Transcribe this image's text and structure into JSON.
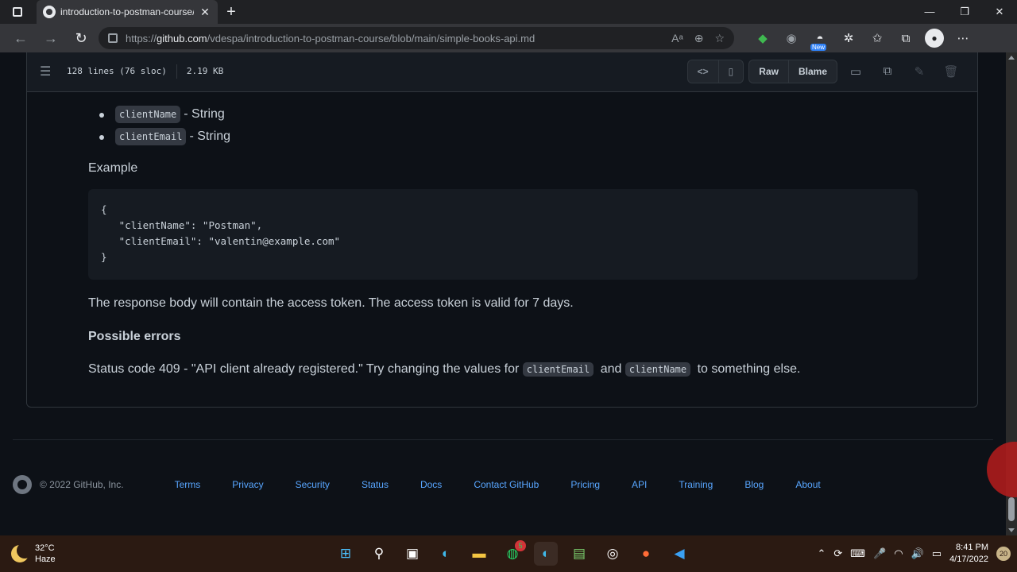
{
  "browser": {
    "tab_title": "introduction-to-postman-course/",
    "new_tab_symbol": "+",
    "close_symbol": "✕",
    "url_prefix": "https://",
    "url_host": "github.com",
    "url_path": "/vdespa/introduction-to-postman-course/blob/main/simple-books-api.md",
    "new_badge": "New"
  },
  "file_header": {
    "lines_info": "128 lines (76 sloc)",
    "size": "2.19 KB",
    "raw_label": "Raw",
    "blame_label": "Blame"
  },
  "content": {
    "fields": [
      {
        "code": "clientName",
        "type": "- String"
      },
      {
        "code": "clientEmail",
        "type": "- String"
      }
    ],
    "example_label": "Example",
    "code_block": "{\n   \"clientName\": \"Postman\",\n   \"clientEmail\": \"valentin@example.com\"\n}",
    "response_text": "The response body will contain the access token. The access token is valid for 7 days.",
    "errors_heading": "Possible errors",
    "status_text_a": "Status code 409 - \"API client already registered.\" Try changing the values for",
    "status_code_a": "clientEmail",
    "status_text_b": "and",
    "status_code_b": "clientName",
    "status_text_c": "to something else."
  },
  "footer": {
    "copyright": "© 2022 GitHub, Inc.",
    "links": [
      "Terms",
      "Privacy",
      "Security",
      "Status",
      "Docs",
      "Contact GitHub",
      "Pricing",
      "API",
      "Training",
      "Blog",
      "About"
    ]
  },
  "taskbar": {
    "temperature": "32°C",
    "weather": "Haze",
    "whatsapp_count": "5",
    "time": "8:41 PM",
    "date": "4/17/2022",
    "notifications": "20"
  },
  "colors": {
    "link": "#58a6ff",
    "background": "#0d1117",
    "accent": "#3fb950"
  }
}
